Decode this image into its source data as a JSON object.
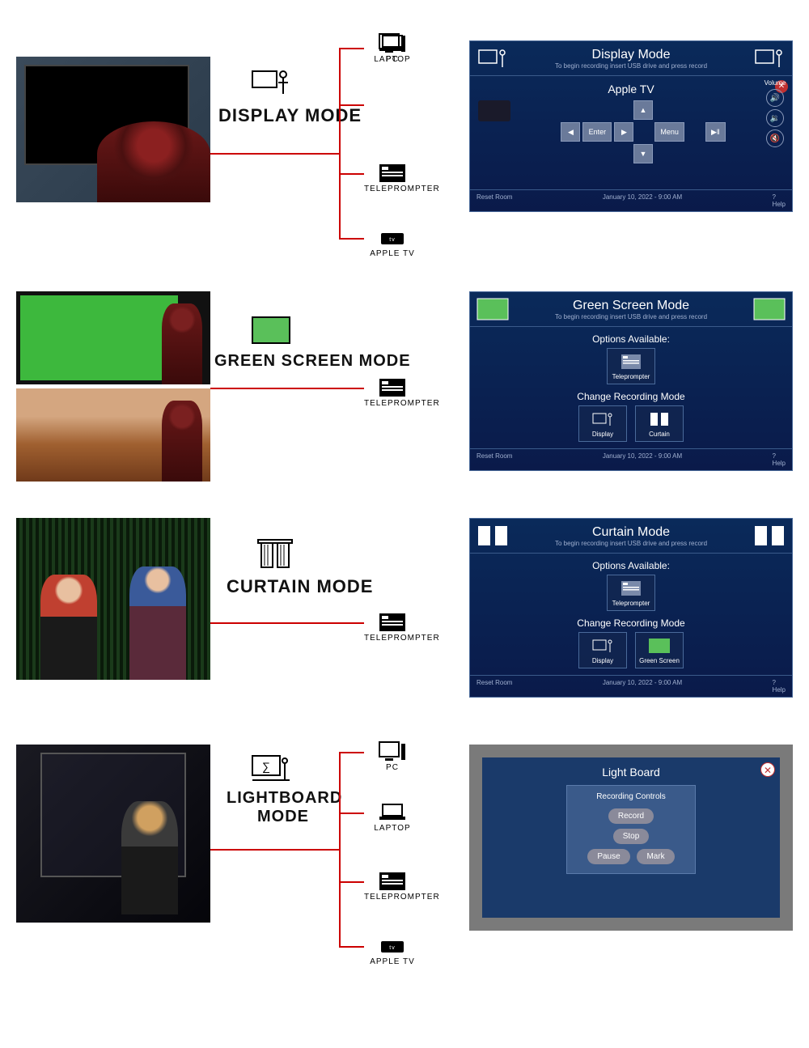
{
  "modes": {
    "display": {
      "label": "DISPLAY MODE",
      "sources": [
        "PC",
        "LAPTOP",
        "TELEPROMPTER",
        "APPLE TV"
      ],
      "panel": {
        "title": "Display Mode",
        "subtitle": "To begin recording insert USB drive and press record",
        "source_label": "Apple TV",
        "buttons": {
          "enter": "Enter",
          "menu": "Menu"
        },
        "volume_label": "Volume",
        "reset": "Reset Room",
        "timestamp": "January 10, 2022 - 9:00 AM",
        "help": "Help"
      }
    },
    "green": {
      "label": "GREEN SCREEN MODE",
      "sources": [
        "TELEPROMPTER"
      ],
      "panel": {
        "title": "Green Screen Mode",
        "subtitle": "To begin recording insert USB drive and press record",
        "options_label": "Options Available:",
        "options": [
          "Teleprompter"
        ],
        "change_label": "Change Recording Mode",
        "change_options": [
          "Display",
          "Curtain"
        ],
        "reset": "Reset Room",
        "timestamp": "January 10, 2022 - 9:00 AM",
        "help": "Help"
      }
    },
    "curtain": {
      "label": "CURTAIN MODE",
      "sources": [
        "TELEPROMPTER"
      ],
      "panel": {
        "title": "Curtain Mode",
        "subtitle": "To begin recording insert USB drive and press record",
        "options_label": "Options Available:",
        "options": [
          "Teleprompter"
        ],
        "change_label": "Change Recording Mode",
        "change_options": [
          "Display",
          "Green Screen"
        ],
        "reset": "Reset Room",
        "timestamp": "January 10, 2022 - 9:00 AM",
        "help": "Help"
      }
    },
    "lightboard": {
      "label": "LIGHTBOARD MODE",
      "sources": [
        "PC",
        "LAPTOP",
        "TELEPROMPTER",
        "APPLE TV"
      ],
      "panel": {
        "title": "Light Board",
        "controls_label": "Recording Controls",
        "buttons": [
          "Record",
          "Stop",
          "Pause",
          "Mark"
        ]
      }
    }
  }
}
